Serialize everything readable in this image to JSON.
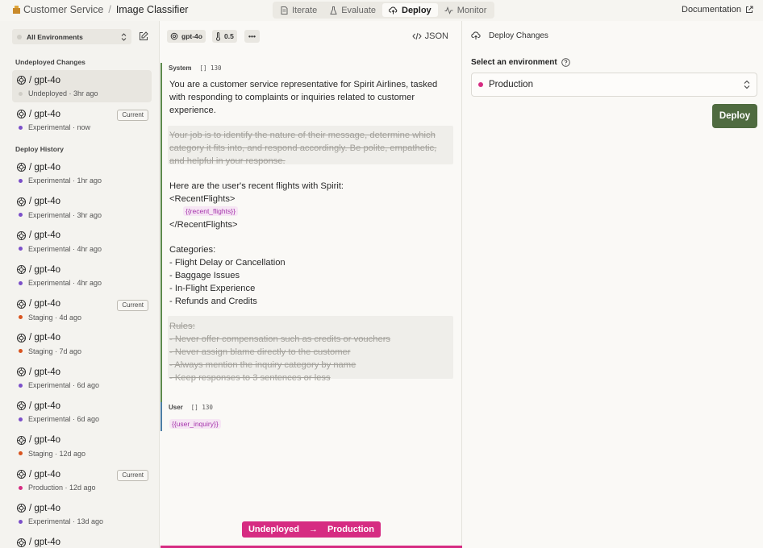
{
  "header": {
    "breadcrumb_project": "Customer Service",
    "breadcrumb_separator": "/",
    "breadcrumb_page": "Image Classifier",
    "tabs": [
      {
        "label": "Iterate",
        "icon": "document-icon",
        "active": false
      },
      {
        "label": "Evaluate",
        "icon": "flask-icon",
        "active": false
      },
      {
        "label": "Deploy",
        "icon": "cloud-upload-icon",
        "active": true
      },
      {
        "label": "Monitor",
        "icon": "pulse-icon",
        "active": false
      }
    ],
    "documentation_label": "Documentation"
  },
  "sidebar": {
    "environment_filter": "All Environments",
    "undeployed_title": "Undeployed Changes",
    "history_title": "Deploy History",
    "items": [
      {
        "model": "/ gpt-4o",
        "status": "Undeployed · 3hr ago",
        "color": "#cfcdc6",
        "badge": "",
        "selected": true
      },
      {
        "model": "/ gpt-4o",
        "status": "Experimental · now",
        "color": "#7b4fc9",
        "badge": "Current",
        "selected": false
      },
      {
        "model": "/ gpt-4o",
        "status": "Experimental · 1hr ago",
        "color": "#7b4fc9",
        "badge": "",
        "selected": false
      },
      {
        "model": "/ gpt-4o",
        "status": "Experimental · 3hr ago",
        "color": "#7b4fc9",
        "badge": "",
        "selected": false
      },
      {
        "model": "/ gpt-4o",
        "status": "Experimental · 4hr ago",
        "color": "#7b4fc9",
        "badge": "",
        "selected": false
      },
      {
        "model": "/ gpt-4o",
        "status": "Experimental · 4hr ago",
        "color": "#7b4fc9",
        "badge": "",
        "selected": false
      },
      {
        "model": "/ gpt-4o",
        "status": "Staging · 4d ago",
        "color": "#d9541f",
        "badge": "Current",
        "selected": false
      },
      {
        "model": "/ gpt-4o",
        "status": "Staging · 7d ago",
        "color": "#d9541f",
        "badge": "",
        "selected": false
      },
      {
        "model": "/ gpt-4o",
        "status": "Experimental · 6d ago",
        "color": "#7b4fc9",
        "badge": "",
        "selected": false
      },
      {
        "model": "/ gpt-4o",
        "status": "Experimental · 6d ago",
        "color": "#7b4fc9",
        "badge": "",
        "selected": false
      },
      {
        "model": "/ gpt-4o",
        "status": "Staging · 12d ago",
        "color": "#d9541f",
        "badge": "",
        "selected": false
      },
      {
        "model": "/ gpt-4o",
        "status": "Production · 12d ago",
        "color": "#d62c82",
        "badge": "Current",
        "selected": false
      },
      {
        "model": "/ gpt-4o",
        "status": "Experimental · 13d ago",
        "color": "#7b4fc9",
        "badge": "",
        "selected": false
      },
      {
        "model": "/ gpt-4o",
        "status": "",
        "color": "#7b4fc9",
        "badge": "",
        "selected": false
      }
    ]
  },
  "editor": {
    "model_chip": "gpt-4o",
    "temperature": "0.5",
    "more_label": "•••",
    "json_label": "JSON",
    "system_label": "System",
    "system_count": "130",
    "intro_text": "You are a customer service representative for Spirit Airlines, tasked\nwith responding to complaints or inquiries related to customer\nexperience.",
    "removed_text": "Your job is to identify the nature of their message, determine which\ncategory it fits into, and respond accordingly. Be polite, empathetic,\nand helpful in your response.",
    "flights_intro": "Here are the user's recent flights with Spirit:\n<RecentFlights>",
    "flights_var": "{{recent_flights}}",
    "flights_close": "</RecentFlights>",
    "categories_text": "Categories:\n- Flight Delay or Cancellation\n- Baggage Issues\n- In-Flight Experience\n- Refunds and Credits",
    "rules_text": "Rules:\n- Never offer compensation such as credits or vouchers\n- Never assign blame directly to the customer\n- Always mention the inquiry category by name\n- Keep responses to 3 sentences or less",
    "user_label": "User",
    "user_count": "130",
    "user_var": "{{user_inquiry}}",
    "banner_from": "Undeployed",
    "banner_arrow": "→",
    "banner_to": "Production"
  },
  "deploy_panel": {
    "title": "Deploy Changes",
    "select_label": "Select an environment",
    "selected_env": "Production",
    "selected_env_color": "#d62c82",
    "deploy_label": "Deploy"
  },
  "colors": {
    "accent_green": "#4f6b40",
    "production_pink": "#d62c82",
    "experimental_purple": "#7b4fc9",
    "staging_orange": "#d9541f"
  }
}
